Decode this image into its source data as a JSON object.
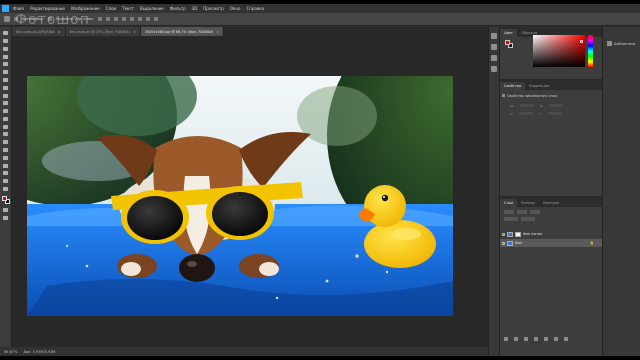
{
  "app": {
    "watermark": "Фотошоп",
    "menu": [
      "Файл",
      "Редактирование",
      "Изображение",
      "Слои",
      "Текст",
      "Выделение",
      "Фильтр",
      "3D",
      "Просмотр",
      "Окно",
      "Справка"
    ]
  },
  "options_bar": {
    "auto_select_label": "Автовыбор:",
    "transform_label": "Показать упр. элем."
  },
  "document_tabs": [
    {
      "label": "без-назв-ия-2/RGB/8#",
      "close": "×"
    },
    {
      "label": "без-назв-ия @ 25% (Фон, RGB/8#)",
      "close": "×"
    },
    {
      "label": "1920x1080.jpg @ 66,7% (Фон, RGB/8#)",
      "close": "×"
    }
  ],
  "status_bar": {
    "zoom": "66,67%",
    "doc_size": "Док: 5,93M/5,93M"
  },
  "color_panel": {
    "tabs": [
      "Цвет",
      "Образцы"
    ],
    "foreground": "#e60000",
    "background": "#111111"
  },
  "properties_panel": {
    "tabs": [
      "Свойства",
      "Коррекция"
    ],
    "title": "Свойства пиксельного слоя",
    "fields": [
      "Ш:",
      "В:",
      "X:",
      "Y:"
    ]
  },
  "layers_panel": {
    "tabs": [
      "Слои",
      "Каналы",
      "Контуры"
    ],
    "layers": [
      {
        "name": "Фон копия",
        "selected": false
      },
      {
        "name": "Фон",
        "selected": true
      }
    ],
    "lock_glyph": "🔒"
  },
  "libraries": {
    "label": "Библиотеки"
  },
  "colors": {
    "accent": "#31a8ff",
    "sky": "#e8f0f4",
    "pool_blue": "#1f7fe0",
    "duck_yellow": "#ffd100",
    "glasses_frame": "#f2c400"
  }
}
